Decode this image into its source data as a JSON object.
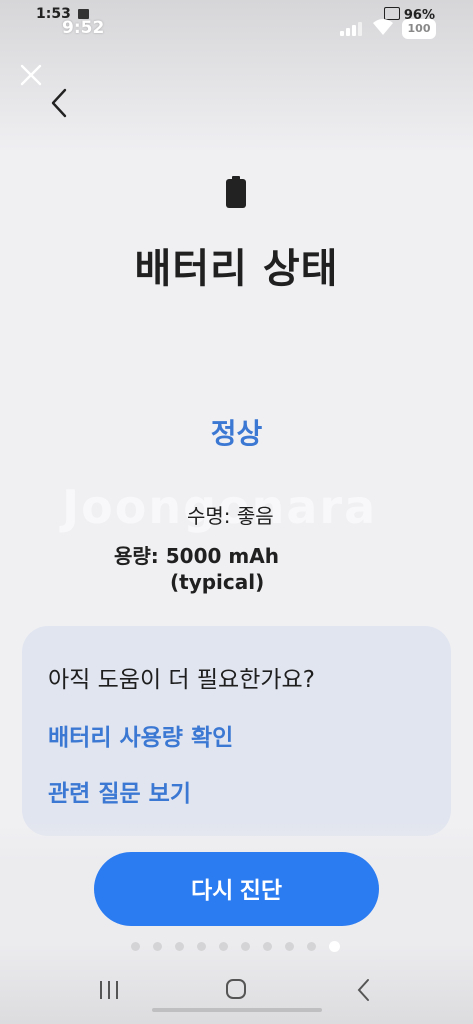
{
  "status_bar": {
    "outer_time": "1:53",
    "inner_time": "9:52",
    "outer_battery": "96%",
    "inner_battery": "100"
  },
  "header": {
    "close_icon": "close-icon",
    "back_icon": "chevron-left-icon",
    "battery_icon": "battery-icon",
    "title": "배터리 상태"
  },
  "result": {
    "status": "정상",
    "lifespan": "수명: 좋음",
    "capacity_line1": "용량: 5000 mAh",
    "capacity_line2": "(typical)"
  },
  "watermark": "Joongonara",
  "help_card": {
    "title": "아직 도움이 더 필요한가요?",
    "links": [
      "배터리 사용량 확인",
      "관련 질문 보기"
    ]
  },
  "actions": {
    "retry_label": "다시 진단"
  },
  "pagination": {
    "total": 10,
    "active": 10
  },
  "colors": {
    "accent": "#3b78d3",
    "button": "#2b7bf1",
    "card": "#e1e5ef"
  }
}
